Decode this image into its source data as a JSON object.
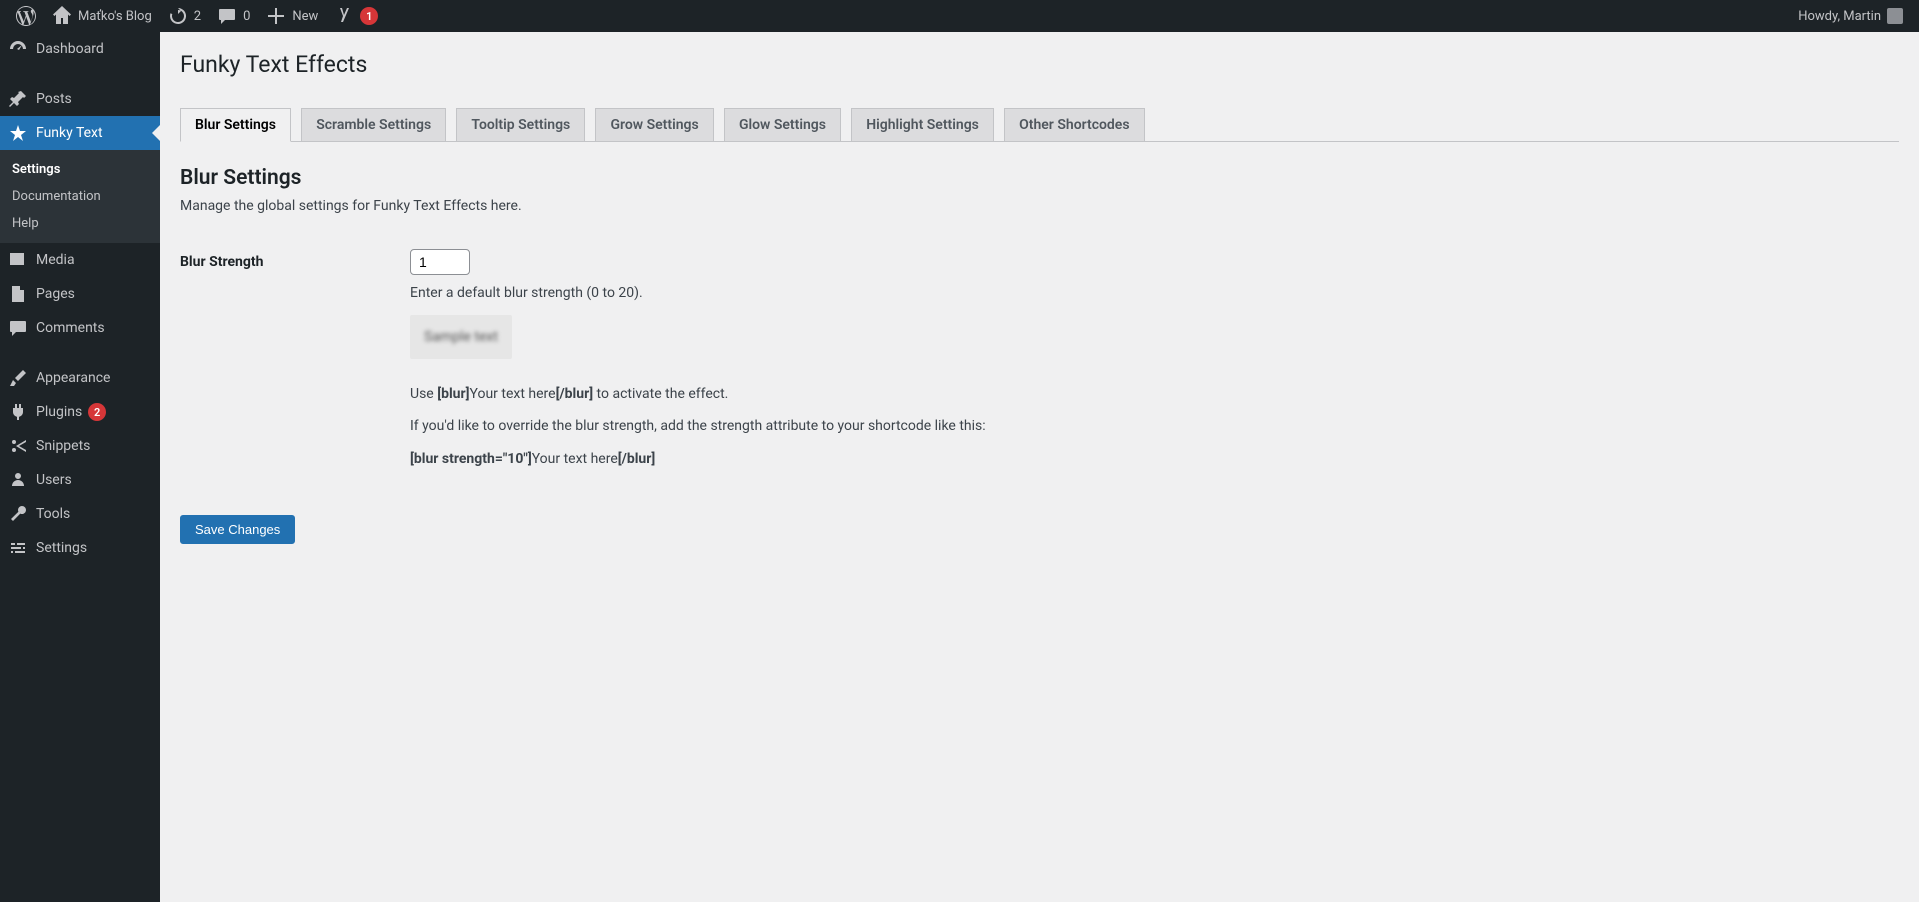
{
  "adminbar": {
    "site_name": "Maťko's Blog",
    "updates_count": "2",
    "comments_count": "0",
    "new_label": "New",
    "yoast_notice": "1",
    "howdy": "Howdy, Martin"
  },
  "sidebar": {
    "items": [
      {
        "label": "Dashboard"
      },
      {
        "label": "Posts"
      },
      {
        "label": "Funky Text"
      },
      {
        "label": "Media"
      },
      {
        "label": "Pages"
      },
      {
        "label": "Comments"
      },
      {
        "label": "Appearance"
      },
      {
        "label": "Plugins",
        "badge": "2"
      },
      {
        "label": "Snippets"
      },
      {
        "label": "Users"
      },
      {
        "label": "Tools"
      },
      {
        "label": "Settings"
      }
    ],
    "funky_submenu": [
      {
        "label": "Settings",
        "current": true
      },
      {
        "label": "Documentation"
      },
      {
        "label": "Help"
      }
    ]
  },
  "page": {
    "title": "Funky Text Effects",
    "tabs": [
      "Blur Settings",
      "Scramble Settings",
      "Tooltip Settings",
      "Grow Settings",
      "Glow Settings",
      "Highlight Settings",
      "Other Shortcodes"
    ],
    "section_title": "Blur Settings",
    "section_desc": "Manage the global settings for Funky Text Effects here.",
    "blur_strength": {
      "label": "Blur Strength",
      "value": "1",
      "hint": "Enter a default blur strength (0 to 20).",
      "sample": "Sample text",
      "usage_prefix": "Use ",
      "usage_open": "[blur]",
      "usage_mid": "Your text here",
      "usage_close": "[/blur]",
      "usage_suffix": " to activate the effect.",
      "override_intro": "If you'd like to override the blur strength, add the strength attribute to your shortcode like this:",
      "override_open": "[blur strength=\"10\"]",
      "override_mid": "Your text here",
      "override_close": "[/blur]"
    },
    "save_label": "Save Changes"
  }
}
